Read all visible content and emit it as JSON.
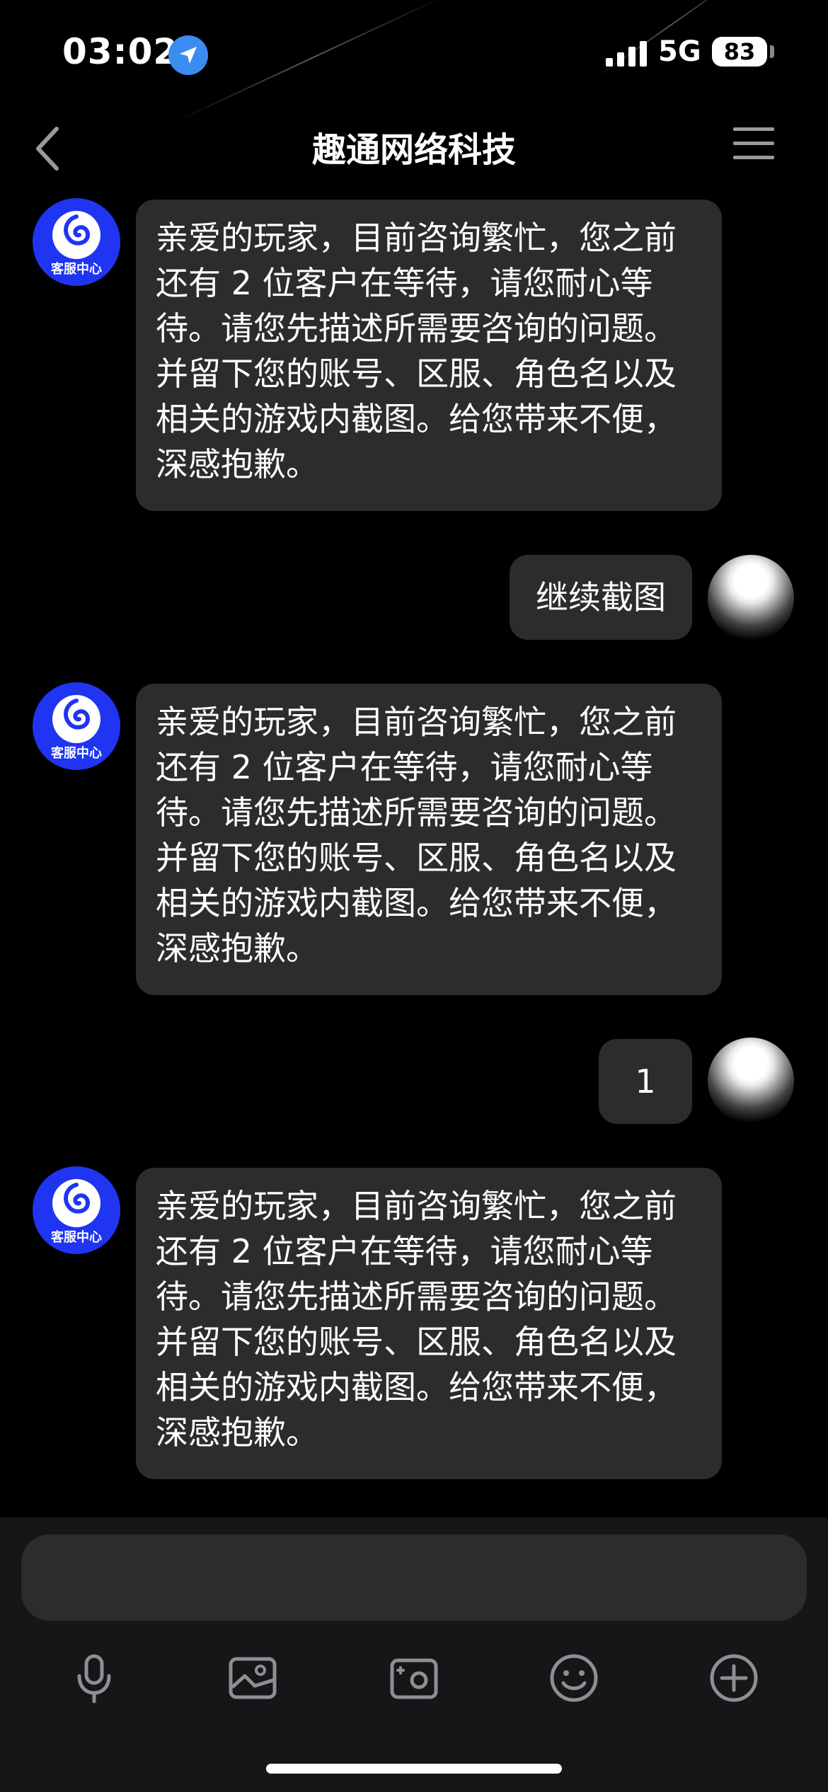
{
  "status_bar": {
    "time": "03:02",
    "network": "5G",
    "battery": "83"
  },
  "nav": {
    "title": "趣通网络科技"
  },
  "service": {
    "avatar_caption": "客服中心"
  },
  "messages": [
    {
      "from": "service",
      "text": "亲爱的玩家，目前咨询繁忙，您之前还有 2 位客户在等待，请您耐心等待。请您先描述所需要咨询的问题。并留下您的账号、区服、角色名以及相关的游戏内截图。给您带来不便，深感抱歉。"
    },
    {
      "from": "user",
      "text": "继续截图"
    },
    {
      "from": "service",
      "text": "亲爱的玩家，目前咨询繁忙，您之前还有 2 位客户在等待，请您耐心等待。请您先描述所需要咨询的问题。并留下您的账号、区服、角色名以及相关的游戏内截图。给您带来不便，深感抱歉。"
    },
    {
      "from": "user",
      "text": "1"
    },
    {
      "from": "service",
      "text": "亲爱的玩家，目前咨询繁忙，您之前还有 2 位客户在等待，请您耐心等待。请您先描述所需要咨询的问题。并留下您的账号、区服、角色名以及相关的游戏内截图。给您带来不便，深感抱歉。"
    }
  ],
  "input": {
    "value": ""
  },
  "toolbar": {
    "icons": [
      "microphone-icon",
      "image-icon",
      "photo-camera-icon",
      "emoji-icon",
      "plus-icon"
    ]
  },
  "colors": {
    "background": "#000000",
    "bubble": "#2c2c2e",
    "service_avatar": "#1f35f2",
    "location_badge": "#3b8cf0"
  }
}
